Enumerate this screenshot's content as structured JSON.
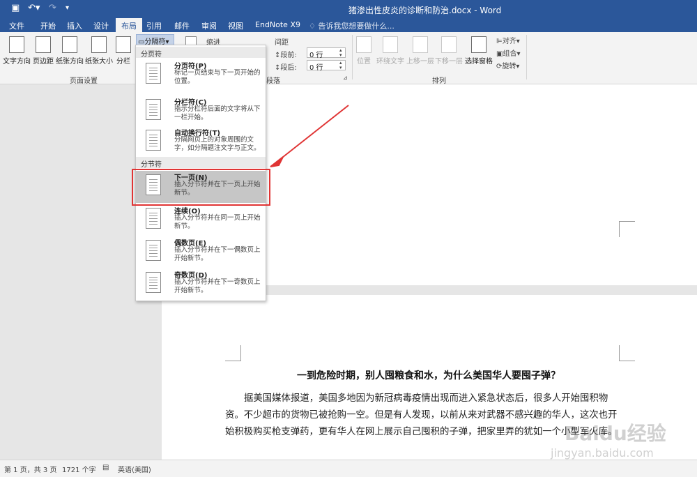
{
  "app": {
    "window_title": "猪渗出性皮炎的诊断和防治.docx - Word"
  },
  "tabs": [
    "文件",
    "开始",
    "插入",
    "设计",
    "布局",
    "引用",
    "邮件",
    "审阅",
    "视图",
    "EndNote X9"
  ],
  "tell_me": "告诉我您想要做什么...",
  "ribbon": {
    "page_setup": {
      "buttons": [
        "文字方向",
        "页边距",
        "纸张方向",
        "纸张大小",
        "分栏"
      ],
      "breaks_button": "分隔符",
      "group_label": "页面设置"
    },
    "paragraph": {
      "indent_label": "缩进",
      "spacing_label": "间距",
      "before_label": "段前:",
      "before_value": "0 行",
      "after_label": "段后:",
      "after_value": "0 行",
      "group_label": "段落"
    },
    "arrange": {
      "buttons": [
        "位置",
        "环绕文字",
        "上移一层",
        "下移一层",
        "选择窗格"
      ],
      "side_items": [
        "对齐",
        "组合",
        "旋转"
      ],
      "group_label": "排列"
    }
  },
  "dropdown": {
    "page_breaks_header": "分页符",
    "section_breaks_header": "分节符",
    "items": [
      {
        "title": "分页符(P)",
        "desc": "标记一页结束与下一页开始的位置。"
      },
      {
        "title": "分栏符(C)",
        "desc": "指示分栏符后面的文字将从下一栏开始。"
      },
      {
        "title": "自动换行符(T)",
        "desc": "分隔网页上的对象周围的文字，如分隔题注文字与正文。"
      },
      {
        "title": "下一页(N)",
        "desc": "插入分节符并在下一页上开始新节。"
      },
      {
        "title": "连续(O)",
        "desc": "插入分节符并在同一页上开始新节。"
      },
      {
        "title": "偶数页(E)",
        "desc": "插入分节符并在下一偶数页上开始新节。"
      },
      {
        "title": "奇数页(D)",
        "desc": "插入分节符并在下一奇数页上开始新节。"
      }
    ]
  },
  "document": {
    "title": "一到危险时期，别人囤粮食和水，为什么美国华人要囤子弹？",
    "body": "据美国媒体报道，美国多地因为新冠病毒疫情出现而进入紧急状态后，很多人开始囤积物资。不少超市的货物已被抢购一空。但是有人发现，以前从来对武器不感兴趣的华人，这次也开始积极购买枪支弹药，更有华人在网上展示自己囤积的子弹，把家里弄的犹如一个小型军火库。"
  },
  "status": {
    "page": "第 1 页，共 3 页",
    "words": "1721 个字",
    "language": "英语(美国)"
  },
  "watermark": {
    "text": "Baidu经验",
    "url": "jingyan.baidu.com"
  },
  "colors": {
    "accent": "#2b579a",
    "highlight_border": "#e03434",
    "arrow": "#e03434"
  }
}
